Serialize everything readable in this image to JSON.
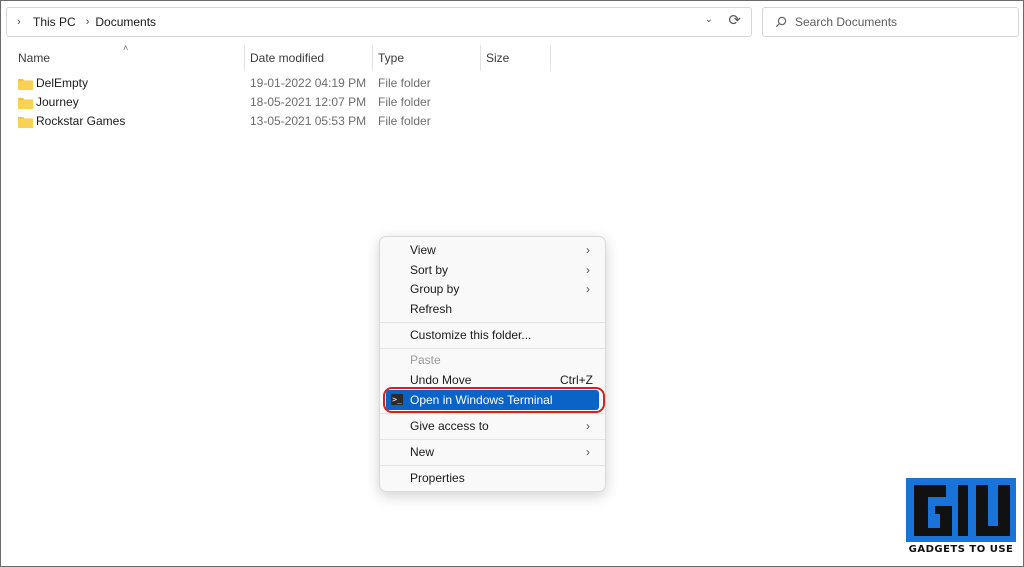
{
  "address": {
    "crumbs": [
      "This PC",
      "Documents"
    ]
  },
  "search": {
    "placeholder": "Search Documents"
  },
  "columns": {
    "name": "Name",
    "date": "Date modified",
    "type": "Type",
    "size": "Size"
  },
  "files": [
    {
      "name": "DelEmpty",
      "date": "19-01-2022 04:19 PM",
      "type": "File folder"
    },
    {
      "name": "Journey",
      "date": "18-05-2021 12:07 PM",
      "type": "File folder"
    },
    {
      "name": "Rockstar Games",
      "date": "13-05-2021 05:53 PM",
      "type": "File folder"
    }
  ],
  "menu": {
    "view": "View",
    "sort_by": "Sort by",
    "group_by": "Group by",
    "refresh": "Refresh",
    "customize": "Customize this folder...",
    "paste": "Paste",
    "undo_move": "Undo Move",
    "undo_shortcut": "Ctrl+Z",
    "open_terminal": "Open in Windows Terminal",
    "give_access": "Give access to",
    "new": "New",
    "properties": "Properties"
  },
  "logo": {
    "text": "GADGETS TO USE"
  },
  "colors": {
    "accent": "#0a64c8",
    "highlight": "#d42222",
    "folder": "#f4c342",
    "logo": "#1a73d9"
  }
}
